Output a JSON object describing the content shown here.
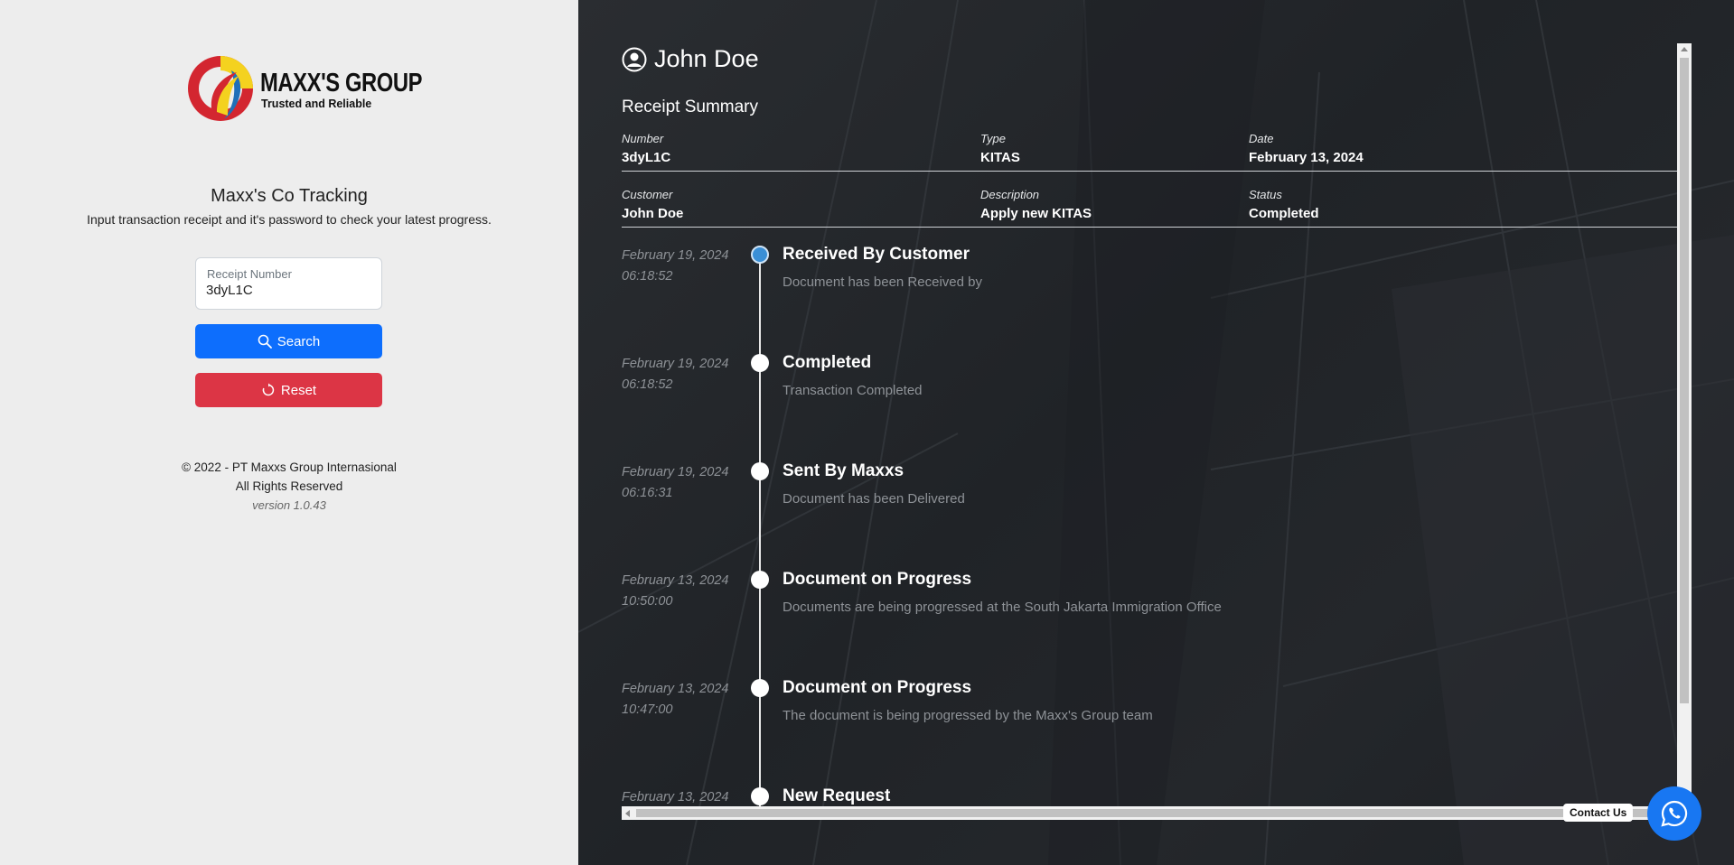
{
  "brand": {
    "name": "MAXX'S GROUP",
    "tagline": "Trusted and Reliable",
    "colors": {
      "red": "#d32630",
      "yellow": "#f4d21f",
      "blue": "#1f6fb8"
    }
  },
  "sidebar": {
    "title": "Maxx's Co Tracking",
    "subtitle": "Input transaction receipt and it's password to check your latest progress.",
    "receipt_field": {
      "label": "Receipt Number",
      "value": "3dyL1C"
    },
    "search_label": "Search",
    "reset_label": "Reset",
    "footer": {
      "copyright": "© 2022 - PT Maxxs Group Internasional",
      "rights": "All Rights Reserved",
      "version": "version 1.0.43"
    }
  },
  "receipt": {
    "customer_name": "John Doe",
    "summary_title": "Receipt Summary",
    "fields": {
      "number": {
        "label": "Number",
        "value": "3dyL1C"
      },
      "type": {
        "label": "Type",
        "value": "KITAS"
      },
      "date": {
        "label": "Date",
        "value": "February 13, 2024"
      },
      "customer": {
        "label": "Customer",
        "value": "John Doe"
      },
      "description": {
        "label": "Description",
        "value": "Apply new KITAS"
      },
      "status": {
        "label": "Status",
        "value": "Completed"
      }
    }
  },
  "timeline": [
    {
      "date": "February 19, 2024",
      "time": "06:18:52",
      "title": "Received By Customer",
      "desc": "Document has been Received by",
      "active": true
    },
    {
      "date": "February 19, 2024",
      "time": "06:18:52",
      "title": "Completed",
      "desc": "Transaction Completed"
    },
    {
      "date": "February 19, 2024",
      "time": "06:16:31",
      "title": "Sent By Maxxs",
      "desc": "Document has been Delivered"
    },
    {
      "date": "February 13, 2024",
      "time": "10:50:00",
      "title": "Document on Progress",
      "desc": "Documents are being progressed at the South Jakarta Immigration Office"
    },
    {
      "date": "February 13, 2024",
      "time": "10:47:00",
      "title": "Document on Progress",
      "desc": "The document is being progressed by the Maxx's Group team"
    },
    {
      "date": "February 13, 2024",
      "time": "",
      "title": "New Request",
      "desc": ""
    }
  ],
  "contact": {
    "label": "Contact Us",
    "icon": "whatsapp-icon"
  },
  "theme": {
    "primary": "#0d6efd",
    "danger": "#dc3545",
    "dot_active": "#3a8fd6"
  }
}
